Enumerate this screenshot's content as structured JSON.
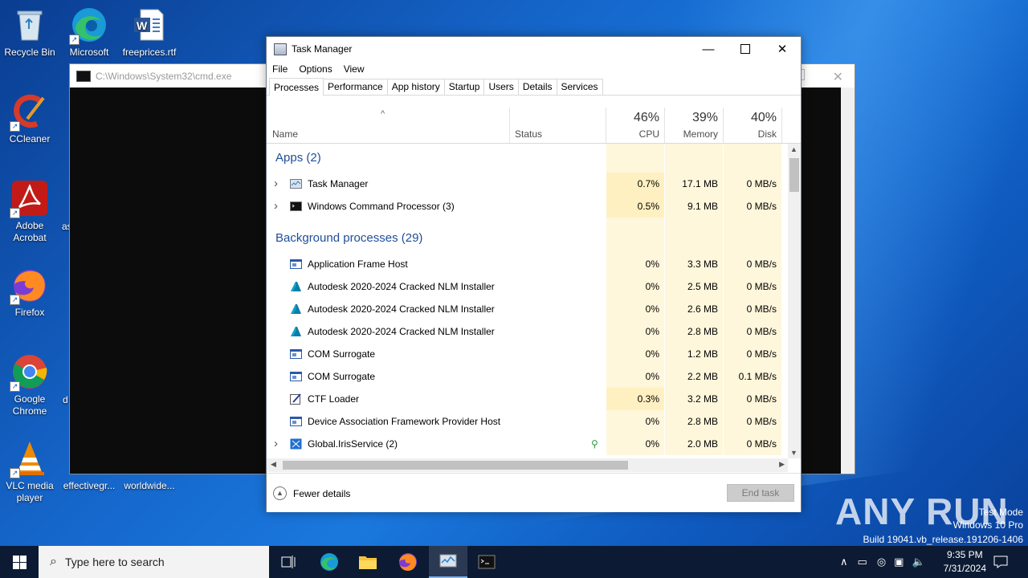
{
  "desktop": {
    "icons": [
      {
        "label": "Recycle Bin"
      },
      {
        "label": "Microsoft Edge"
      },
      {
        "label": "freeprices.rtf"
      },
      {
        "label": "CCleaner"
      },
      {
        "label": "Adobe Acrobat"
      },
      {
        "label": "Firefox"
      },
      {
        "label": "Google Chrome"
      },
      {
        "label": "VLC media player"
      },
      {
        "label": "effectivegr..."
      },
      {
        "label": "worldwide..."
      }
    ],
    "partial_labels": [
      "as",
      "d"
    ]
  },
  "cmd_window": {
    "title": "C:\\Windows\\System32\\cmd.exe"
  },
  "task_manager": {
    "title": "Task Manager",
    "menu": [
      "File",
      "Options",
      "View"
    ],
    "tabs": [
      "Processes",
      "Performance",
      "App history",
      "Startup",
      "Users",
      "Details",
      "Services"
    ],
    "active_tab": "Processes",
    "columns": {
      "name": "Name",
      "status": "Status",
      "cpu": {
        "pct": "46%",
        "label": "CPU"
      },
      "memory": {
        "pct": "39%",
        "label": "Memory"
      },
      "disk": {
        "pct": "40%",
        "label": "Disk"
      }
    },
    "groups": {
      "apps": "Apps (2)",
      "background": "Background processes (29)"
    },
    "apps": [
      {
        "name": "Task Manager",
        "cpu": "0.7%",
        "memory": "17.1 MB",
        "disk": "0 MB/s",
        "icon": "task-manager-icon",
        "expandable": true
      },
      {
        "name": "Windows Command Processor (3)",
        "cpu": "0.5%",
        "memory": "9.1 MB",
        "disk": "0 MB/s",
        "icon": "cmd-icon",
        "expandable": true
      }
    ],
    "background": [
      {
        "name": "Application Frame Host",
        "cpu": "0%",
        "memory": "3.3 MB",
        "disk": "0 MB/s",
        "icon": "app-window-icon",
        "expandable": false
      },
      {
        "name": "Autodesk 2020-2024 Cracked NLM Installer",
        "cpu": "0%",
        "memory": "2.5 MB",
        "disk": "0 MB/s",
        "icon": "autodesk-icon",
        "expandable": false
      },
      {
        "name": "Autodesk 2020-2024 Cracked NLM Installer",
        "cpu": "0%",
        "memory": "2.6 MB",
        "disk": "0 MB/s",
        "icon": "autodesk-icon",
        "expandable": false
      },
      {
        "name": "Autodesk 2020-2024 Cracked NLM Installer",
        "cpu": "0%",
        "memory": "2.8 MB",
        "disk": "0 MB/s",
        "icon": "autodesk-icon",
        "expandable": false
      },
      {
        "name": "COM Surrogate",
        "cpu": "0%",
        "memory": "1.2 MB",
        "disk": "0 MB/s",
        "icon": "app-window-icon",
        "expandable": false
      },
      {
        "name": "COM Surrogate",
        "cpu": "0%",
        "memory": "2.2 MB",
        "disk": "0.1 MB/s",
        "icon": "app-window-icon",
        "expandable": false
      },
      {
        "name": "CTF Loader",
        "cpu": "0.3%",
        "memory": "3.2 MB",
        "disk": "0 MB/s",
        "icon": "ctf-loader-icon",
        "expandable": false
      },
      {
        "name": "Device Association Framework Provider Host",
        "cpu": "0%",
        "memory": "2.8 MB",
        "disk": "0 MB/s",
        "icon": "app-window-icon",
        "expandable": false
      },
      {
        "name": "Global.IrisService (2)",
        "cpu": "0%",
        "memory": "2.0 MB",
        "disk": "0 MB/s",
        "icon": "iris-service-icon",
        "expandable": true,
        "status_icon": "leaf-icon"
      }
    ],
    "footer": {
      "fewer_details": "Fewer details",
      "end_task": "End task"
    }
  },
  "watermark": {
    "text": "ANY RUN"
  },
  "system_info": [
    "Test Mode",
    "Windows 10 Pro",
    "Build 19041.vb_release.191206-1406"
  ],
  "taskbar": {
    "search_placeholder": "Type here to search",
    "time": "9:35 PM",
    "date": "7/31/2024"
  }
}
